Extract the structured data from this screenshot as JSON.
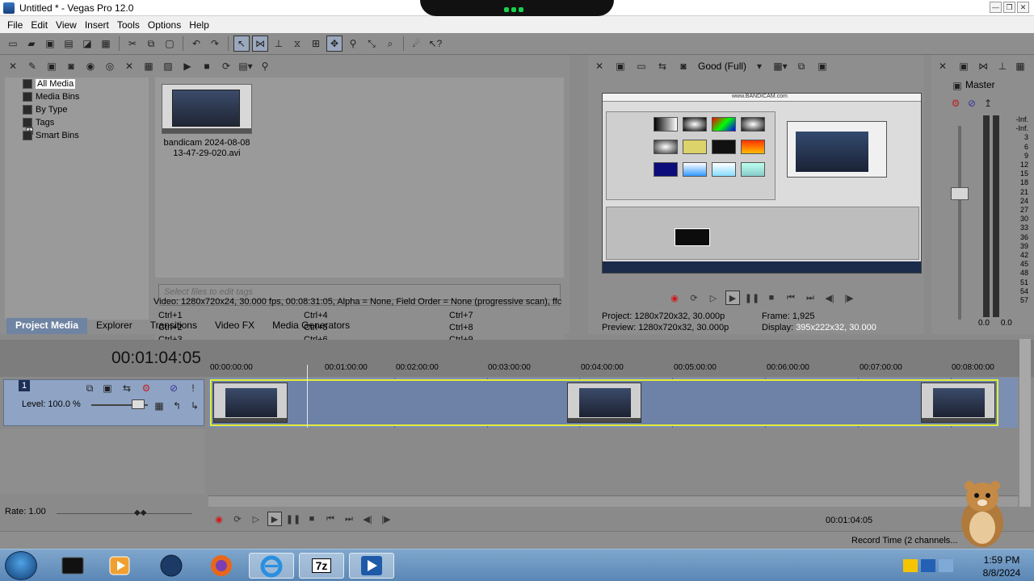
{
  "window": {
    "title": "Untitled * - Vegas Pro 12.0",
    "min": "—",
    "max": "❐",
    "close": "✕"
  },
  "menu": [
    "File",
    "Edit",
    "View",
    "Insert",
    "Tools",
    "Options",
    "Help"
  ],
  "media_tree": [
    "All Media",
    "Media Bins",
    "By Type",
    "Tags",
    "Smart Bins"
  ],
  "media_file": {
    "line1": "bandicam 2024-08-08",
    "line2": "13-47-29-020.avi"
  },
  "tags": {
    "placeholder": "Select files to edit tags",
    "shortcuts": [
      "Ctrl+1",
      "Ctrl+2",
      "Ctrl+3",
      "Ctrl+4",
      "Ctrl+5",
      "Ctrl+6",
      "Ctrl+7",
      "Ctrl+8",
      "Ctrl+9"
    ]
  },
  "media_info": "Video: 1280x720x24, 30.000 fps, 00:08:31:05, Alpha = None, Field Order = None (progressive scan), ffc",
  "tabs": [
    "Project Media",
    "Explorer",
    "Transitions",
    "Video FX",
    "Media Generators"
  ],
  "preview": {
    "quality": "Good (Full)",
    "watermark": "www.BANDICAM.com",
    "project_label": "Project:",
    "project_value": "1280x720x32, 30.000p",
    "preview_label": "Preview:",
    "preview_value": "1280x720x32, 30.000p",
    "frame_label": "Frame:",
    "frame_value": "1,925",
    "display_label": "Display:",
    "display_value": "395x222x32, 30.000"
  },
  "master": {
    "label": "Master",
    "scale": [
      "-Inf.",
      "-Inf.",
      "3",
      "6",
      "9",
      "12",
      "15",
      "18",
      "21",
      "24",
      "27",
      "30",
      "33",
      "36",
      "39",
      "42",
      "45",
      "48",
      "51",
      "54",
      "57"
    ],
    "left_val": "0.0",
    "right_val": "0.0"
  },
  "timeline": {
    "timecode": "00:01:04:05",
    "ruler": [
      "00:00:00:00",
      "00:01:00:00",
      "00:02:00:00",
      "00:03:00:00",
      "00:04:00:00",
      "00:05:00:00",
      "00:06:00:00",
      "00:07:00:00",
      "00:08:00:00"
    ],
    "track_number": "1",
    "level": "Level: 100.0 %",
    "rate": "Rate: 1.00",
    "cursor_time": "00:01:04:05",
    "record_time": "Record Time (2 channels..."
  },
  "taskbar": {
    "apps": [
      "cmd",
      "media",
      "ps",
      "firefox",
      "ie",
      "7z",
      "vegas"
    ],
    "sevenzip_label": "7z",
    "time": "1:59 PM",
    "date": "8/8/2024"
  },
  "colors": {
    "panel_bg": "#8e8e8e",
    "track_blue": "#7a8fb2",
    "event_border": "#e6ed37",
    "tab_active": "#6f83a2",
    "record_red": "#d01818"
  }
}
